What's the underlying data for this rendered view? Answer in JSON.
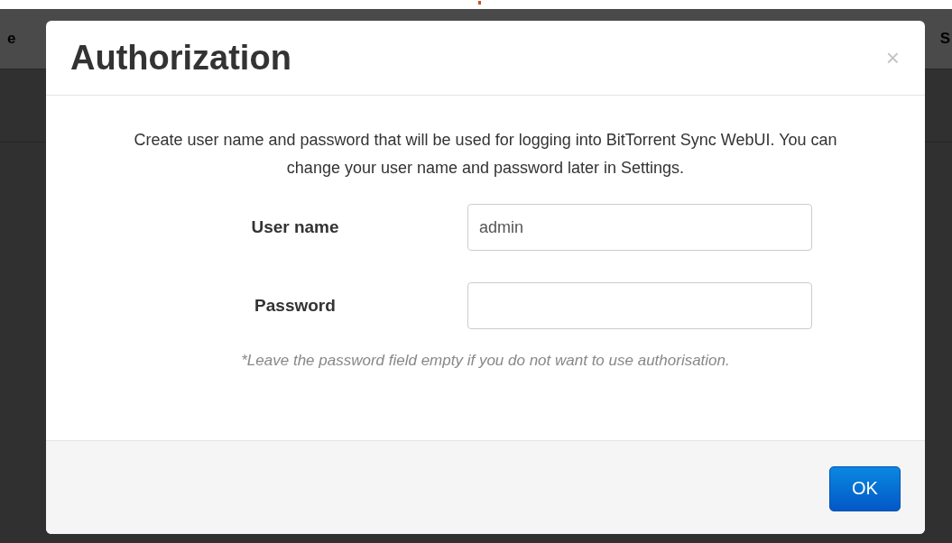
{
  "background": {
    "header_cells": [
      "e",
      "S"
    ]
  },
  "dialog": {
    "title": "Authorization",
    "close": "×",
    "description": "Create user name and password that will be used for logging into BitTorrent Sync WebUI. You can change your user name and password later in Settings.",
    "fields": [
      {
        "label": "User name",
        "value": "admin"
      },
      {
        "label": "Password"
      }
    ],
    "note": "*Leave the password field empty if you do not want to use authorisation.",
    "button": "OK"
  }
}
